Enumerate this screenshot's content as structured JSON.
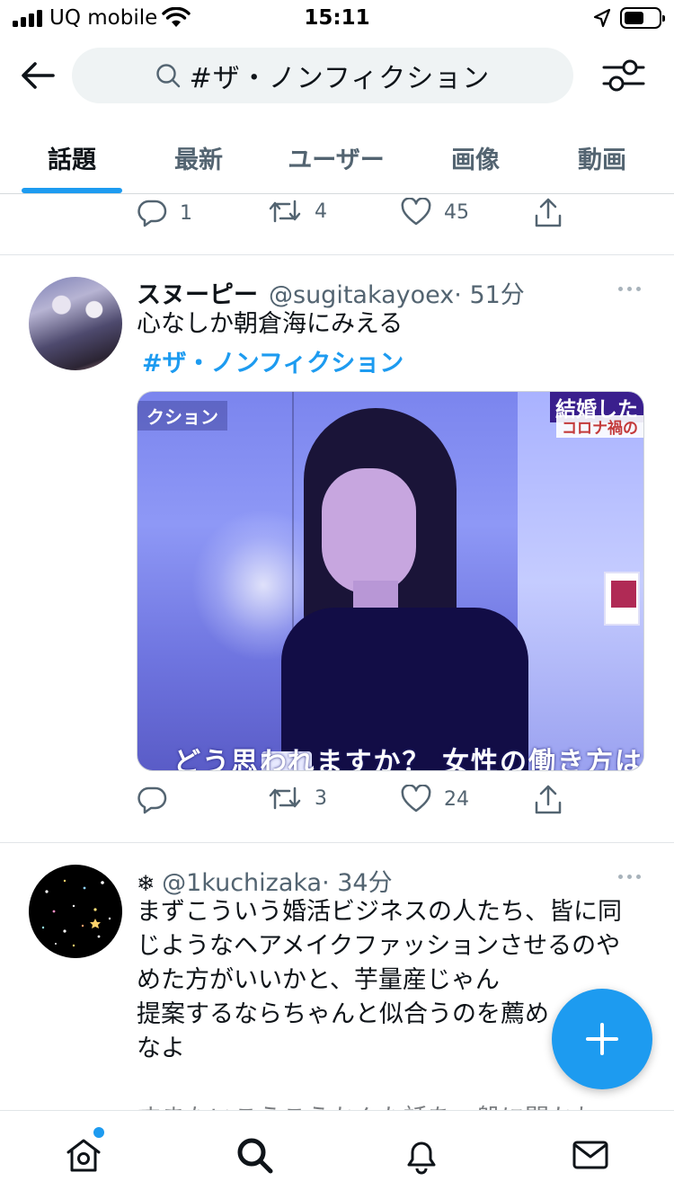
{
  "status_bar": {
    "carrier": "UQ mobile",
    "time": "15:11",
    "battery_level": 0.62
  },
  "header": {
    "search_query": "#ザ・ノンフィクション"
  },
  "tabs": [
    {
      "label": "話題",
      "active": true
    },
    {
      "label": "最新",
      "active": false
    },
    {
      "label": "ユーザー",
      "active": false
    },
    {
      "label": "画像",
      "active": false
    },
    {
      "label": "動画",
      "active": false
    }
  ],
  "tweets": [
    {
      "replies": "1",
      "retweets": "4",
      "likes": "45"
    },
    {
      "display_name": "スヌーピー",
      "handle": "@sugitakayoex",
      "time": "· 51分",
      "text": "心なしか朝倉海にみえる",
      "hashtag": "#ザ・ノンフィクション",
      "media": {
        "caption_top_left": "クション",
        "caption_top_right_1": "結婚した",
        "caption_top_right_2": "コロナ禍の",
        "caption_bottom": "どう思われますか？ 女性の働き方は"
      },
      "replies": "",
      "retweets": "3",
      "likes": "24"
    },
    {
      "display_name": "❄",
      "handle": "@1kuchizaka",
      "time": "· 34分",
      "text": "まずこういう婚活ビジネスの人たち、皆に同\nじようなヘアメイクファッションさせるのや\nめた方がいいかと、芋量産じゃん\n提案するならちゃんと似合うのを薦め\nなよ",
      "partial_next_line": "すまないこうこうかんた話を一般に聞かれ"
    }
  ],
  "colors": {
    "accent": "#1d9bf0",
    "text_primary": "#0f1419",
    "text_secondary": "#536471"
  },
  "icons": {
    "back": "arrow-left-icon",
    "search": "search-icon",
    "filter": "sliders-icon",
    "reply": "speech-bubble-icon",
    "retweet": "retweet-icon",
    "like": "heart-icon",
    "share": "share-icon",
    "more": "ellipsis-icon",
    "compose": "plus-icon",
    "home": "home-icon",
    "explore": "search-icon",
    "notifications": "bell-icon",
    "messages": "envelope-icon"
  }
}
